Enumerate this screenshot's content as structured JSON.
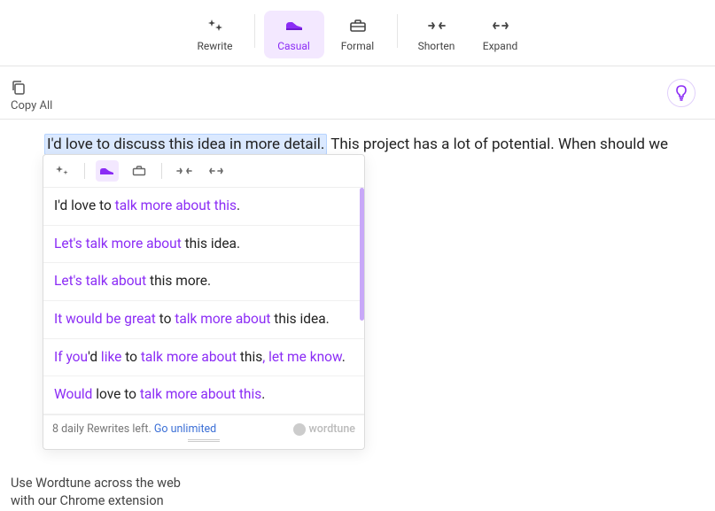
{
  "toolbar": {
    "rewrite": "Rewrite",
    "casual": "Casual",
    "formal": "Formal",
    "shorten": "Shorten",
    "expand": "Expand"
  },
  "subbar": {
    "copy_all": "Copy All"
  },
  "editor": {
    "highlighted": "I'd love to discuss this idea in more detail.",
    "rest": " This project has a lot of potential. When should we set"
  },
  "suggestions": [
    [
      {
        "t": "I'd love to "
      },
      {
        "t": "talk more about this",
        "em": true
      },
      {
        "t": "."
      }
    ],
    [
      {
        "t": "Let's ",
        "em": true
      },
      {
        "t": "talk more about",
        "em": true
      },
      {
        "t": " this idea."
      }
    ],
    [
      {
        "t": "Let's ",
        "em": true
      },
      {
        "t": "talk about",
        "em": true
      },
      {
        "t": " this more."
      }
    ],
    [
      {
        "t": "It would be great",
        "em": true
      },
      {
        "t": " to "
      },
      {
        "t": "talk more about",
        "em": true
      },
      {
        "t": " this idea."
      }
    ],
    [
      {
        "t": "If you",
        "em": true
      },
      {
        "t": "'d "
      },
      {
        "t": "like",
        "em": true
      },
      {
        "t": " to "
      },
      {
        "t": "talk more about",
        "em": true
      },
      {
        "t": " this"
      },
      {
        "t": ", ",
        "em": true
      },
      {
        "t": "let me know",
        "em": true
      },
      {
        "t": "."
      }
    ],
    [
      {
        "t": "Would",
        "em": true
      },
      {
        "t": " love to "
      },
      {
        "t": "talk more about this",
        "em": true
      },
      {
        "t": "."
      }
    ]
  ],
  "footer": {
    "left_a": "8 daily Rewrites left. ",
    "link": "Go unlimited",
    "brand": "wordtune"
  },
  "promo": {
    "line1": "Use Wordtune across the web",
    "line2": "with our Chrome extension"
  },
  "colors": {
    "accent": "#8b2cf5"
  }
}
